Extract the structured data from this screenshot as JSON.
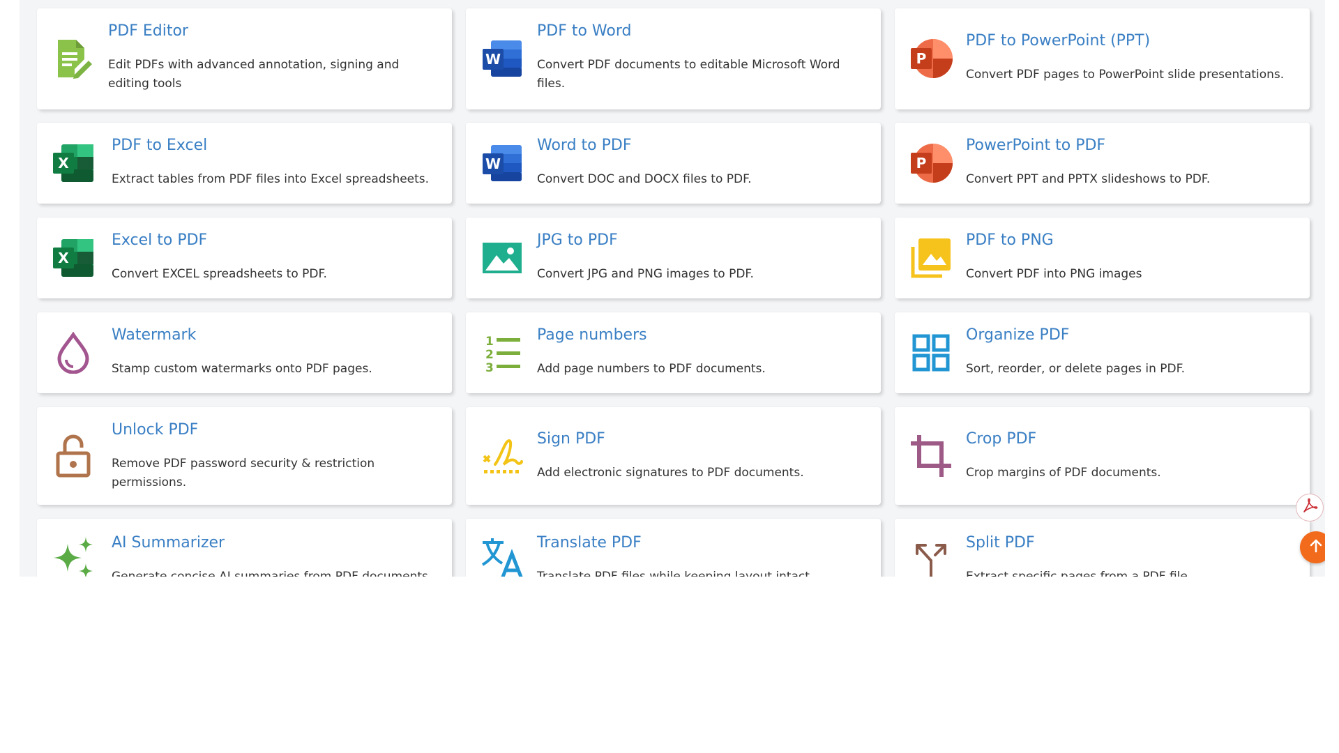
{
  "tools": [
    {
      "title": "PDF Editor",
      "desc": "Edit PDFs with advanced annotation, signing and editing tools",
      "icon": "pdf-editor-icon"
    },
    {
      "title": "PDF to Word",
      "desc": "Convert PDF documents to editable Microsoft Word files.",
      "icon": "word-icon"
    },
    {
      "title": "PDF to PowerPoint (PPT)",
      "desc": "Convert PDF pages to PowerPoint slide presentations.",
      "icon": "powerpoint-icon"
    },
    {
      "title": "PDF to Excel",
      "desc": "Extract tables from PDF files into Excel spreadsheets.",
      "icon": "excel-icon"
    },
    {
      "title": "Word to PDF",
      "desc": "Convert DOC and DOCX files to PDF.",
      "icon": "word-icon"
    },
    {
      "title": "PowerPoint to PDF",
      "desc": "Convert PPT and PPTX slideshows to PDF.",
      "icon": "powerpoint-icon"
    },
    {
      "title": "Excel to PDF",
      "desc": "Convert EXCEL spreadsheets to PDF.",
      "icon": "excel-icon"
    },
    {
      "title": "JPG to PDF",
      "desc": "Convert JPG and PNG images to PDF.",
      "icon": "image-icon"
    },
    {
      "title": "PDF to PNG",
      "desc": "Convert PDF into PNG images",
      "icon": "photo-library-icon"
    },
    {
      "title": "Watermark",
      "desc": "Stamp custom watermarks onto PDF pages.",
      "icon": "water-drop-icon"
    },
    {
      "title": "Page numbers",
      "desc": "Add page numbers to PDF documents.",
      "icon": "numbered-list-icon"
    },
    {
      "title": "Organize PDF",
      "desc": "Sort, reorder, or delete pages in PDF.",
      "icon": "grid-icon"
    },
    {
      "title": "Unlock PDF",
      "desc": "Remove PDF password security & restriction permissions.",
      "icon": "unlock-icon"
    },
    {
      "title": "Sign PDF",
      "desc": "Add electronic signatures to PDF documents.",
      "icon": "signature-icon"
    },
    {
      "title": "Crop PDF",
      "desc": "Crop margins of PDF documents.",
      "icon": "crop-icon"
    },
    {
      "title": "AI Summarizer",
      "desc": "Generate concise AI summaries from PDF documents.",
      "icon": "sparkle-icon"
    },
    {
      "title": "Translate PDF",
      "desc": "Translate PDF files while keeping layout intact.",
      "icon": "translate-icon"
    },
    {
      "title": "Split PDF",
      "desc": "Extract specific pages from a PDF file.",
      "icon": "split-icon"
    }
  ],
  "colors": {
    "title": "#3a7fc4",
    "accent_orange": "#f26a1b",
    "excel_green": "#1f7a45",
    "word_blue": "#2b5bb5",
    "ppt_red": "#d24726"
  },
  "floating": {
    "pdf_button_icon": "acrobat-icon",
    "scroll_top_icon": "arrow-up-icon"
  }
}
